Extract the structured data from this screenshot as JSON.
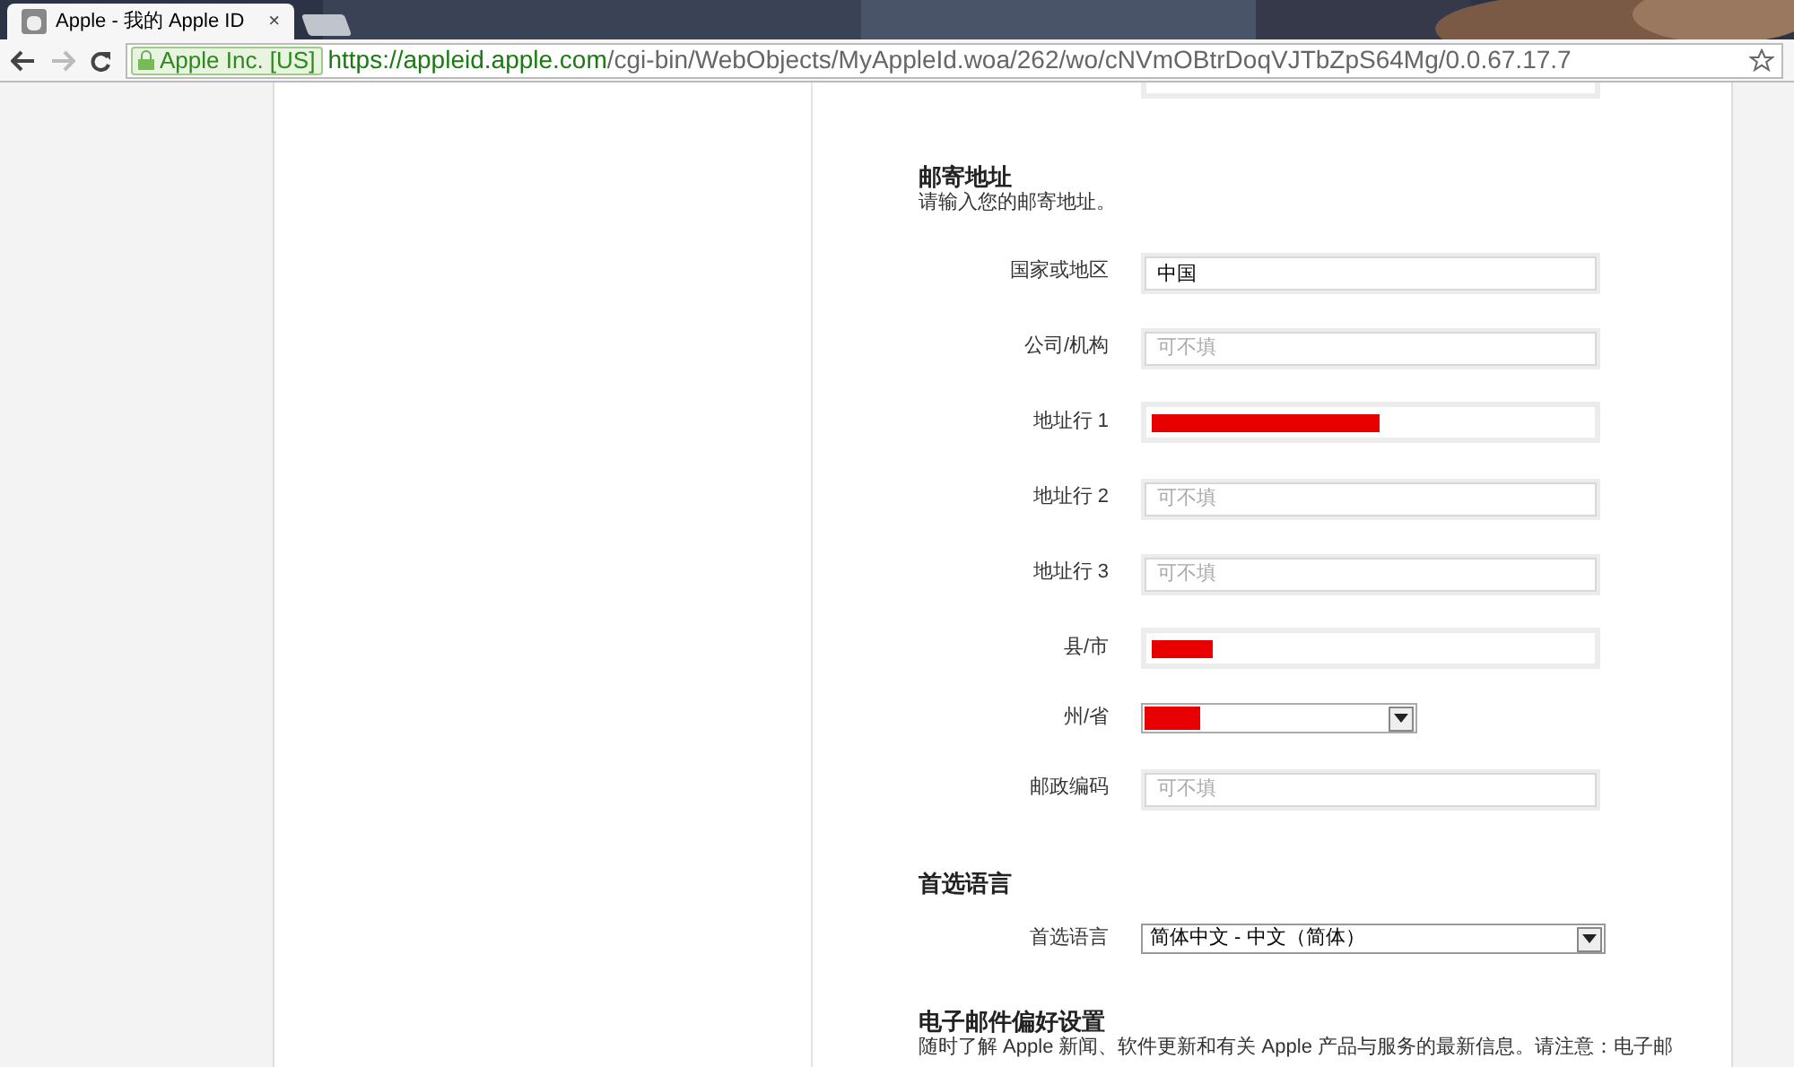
{
  "browser": {
    "tabs": [
      {
        "title": "Apple - 我的 Apple ID",
        "close": "×",
        "selected": true
      }
    ],
    "identity": "Apple Inc. [US]",
    "url_host": "https://appleid.apple.com",
    "url_path": "/cgi-bin/WebObjects/MyAppleId.woa/262/wo/cNVmOBtrDoqVJTbZpS64Mg/0.0.67.17.7"
  },
  "sections": [
    {
      "title": "邮寄地址",
      "description": "请输入您的邮寄地址。",
      "fields": [
        {
          "label": "国家或地区",
          "kind": "text",
          "value": "中国"
        },
        {
          "label": "公司/机构",
          "kind": "text",
          "placeholder": "可不填"
        },
        {
          "label": "地址行 1",
          "kind": "redacted"
        },
        {
          "label": "地址行 2",
          "kind": "text",
          "placeholder": "可不填"
        },
        {
          "label": "地址行 3",
          "kind": "text",
          "placeholder": "可不填"
        },
        {
          "label": "县/市",
          "kind": "redacted"
        },
        {
          "label": "州/省",
          "kind": "redacted_select"
        },
        {
          "label": "邮政编码",
          "kind": "text",
          "placeholder": "可不填"
        }
      ]
    },
    {
      "title": "首选语言",
      "fields": [
        {
          "label": "首选语言",
          "kind": "select",
          "value": "简体中文 - 中文（简体）"
        }
      ]
    },
    {
      "title": "电子邮件偏好设置",
      "description": "随时了解 Apple 新闻、软件更新和有关 Apple 产品与服务的最新信息。请注意：电子邮"
    }
  ]
}
